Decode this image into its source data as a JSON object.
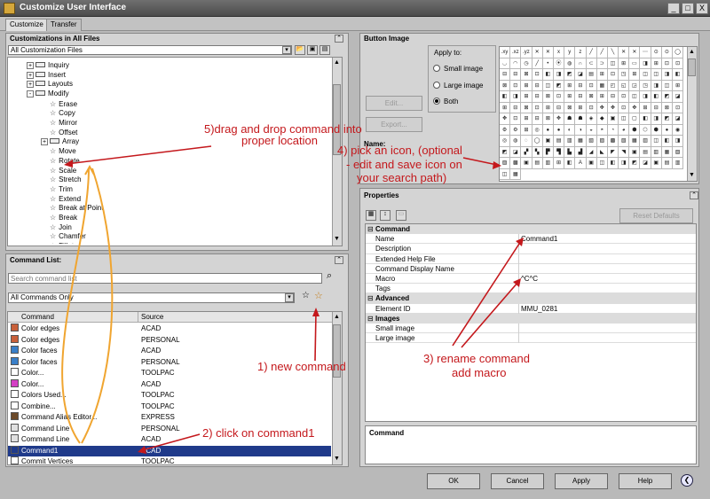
{
  "window": {
    "title": "Customize User Interface",
    "min_glyph": "_",
    "max_glyph": "□",
    "close_glyph": "X"
  },
  "tabs": [
    "Customize",
    "Transfer"
  ],
  "customizations": {
    "title": "Customizations in All Files",
    "files_dropdown": "All Customization Files",
    "tree": [
      {
        "label": "Inquiry",
        "depth": 0,
        "expand": "+",
        "kind": "folder"
      },
      {
        "label": "Insert",
        "depth": 0,
        "expand": "+",
        "kind": "folder"
      },
      {
        "label": "Layouts",
        "depth": 0,
        "expand": "+",
        "kind": "folder"
      },
      {
        "label": "Modify",
        "depth": 0,
        "expand": "-",
        "kind": "folder"
      },
      {
        "label": "Erase",
        "depth": 1,
        "kind": "command"
      },
      {
        "label": "Copy",
        "depth": 1,
        "kind": "command"
      },
      {
        "label": "Mirror",
        "depth": 1,
        "kind": "command"
      },
      {
        "label": "Offset",
        "depth": 1,
        "kind": "command"
      },
      {
        "label": "Array",
        "depth": 1,
        "expand": "+",
        "kind": "folder"
      },
      {
        "label": "Move",
        "depth": 1,
        "kind": "command"
      },
      {
        "label": "Rotate",
        "depth": 1,
        "kind": "command"
      },
      {
        "label": "Scale",
        "depth": 1,
        "kind": "command"
      },
      {
        "label": "Stretch",
        "depth": 1,
        "kind": "command"
      },
      {
        "label": "Trim",
        "depth": 1,
        "kind": "command"
      },
      {
        "label": "Extend",
        "depth": 1,
        "kind": "command"
      },
      {
        "label": "Break at Point",
        "depth": 1,
        "kind": "command"
      },
      {
        "label": "Break",
        "depth": 1,
        "kind": "command"
      },
      {
        "label": "Join",
        "depth": 1,
        "kind": "command"
      },
      {
        "label": "Chamfer",
        "depth": 1,
        "kind": "command"
      },
      {
        "label": "Fillet",
        "depth": 1,
        "kind": "command"
      }
    ]
  },
  "command_list": {
    "title": "Command List:",
    "search_placeholder": "Search command list",
    "filter": "All Commands Only",
    "columns": [
      "Command",
      "Source"
    ],
    "rows": [
      {
        "name": "Color edges",
        "source": "ACAD",
        "icon_color": "#c8603a"
      },
      {
        "name": "Color edges",
        "source": "PERSONAL",
        "icon_color": "#c8603a"
      },
      {
        "name": "Color faces",
        "source": "ACAD",
        "icon_color": "#3a7fc8"
      },
      {
        "name": "Color faces",
        "source": "PERSONAL",
        "icon_color": "#3a7fc8"
      },
      {
        "name": "Color...",
        "source": "TOOLPAC",
        "icon_color": "#ffffff"
      },
      {
        "name": "Color...",
        "source": "ACAD",
        "icon_color": "#d43fc4"
      },
      {
        "name": "Colors Used...",
        "source": "TOOLPAC",
        "icon_color": "#ffffff"
      },
      {
        "name": "Combine...",
        "source": "TOOLPAC",
        "icon_color": "#ffffff"
      },
      {
        "name": "Command Alias Editor...",
        "source": "EXPRESS",
        "icon_color": "#6c4a2a"
      },
      {
        "name": "Command Line",
        "source": "PERSONAL",
        "icon_color": "#e0e0e0"
      },
      {
        "name": "Command Line",
        "source": "ACAD",
        "icon_color": "#e0e0e0"
      },
      {
        "name": "Command1",
        "source": "ACAD",
        "icon_color": "#1f3a8a",
        "selected": true
      },
      {
        "name": "Commit Vertices",
        "source": "TOOLPAC",
        "icon_color": "#ffffff"
      }
    ]
  },
  "button_image": {
    "title": "Button Image",
    "apply_to_label": "Apply to:",
    "options": [
      "Small image",
      "Large image",
      "Both"
    ],
    "selected_option": "Both",
    "edit_label": "Edit...",
    "export_label": "Export...",
    "name_label": "Name:",
    "icons": [
      ".xy",
      ".xz",
      ".yz",
      "✕",
      "✕",
      "x",
      "y",
      "z",
      "╱",
      "╱",
      "╲",
      "✕",
      "✕",
      "⋯",
      "⊙",
      "⊙",
      "◯",
      "◡",
      "◠",
      "◷",
      "╱",
      "•",
      "⦿",
      "◍",
      "∩",
      "⊂",
      "⊃",
      "◫",
      "⊞",
      "▭",
      "◨",
      "⊞",
      "⊡",
      "⊡",
      "⊟",
      "⊟",
      "⊠",
      "⊡",
      "◧",
      "◨",
      "◩",
      "◪",
      "▤",
      "⊞",
      "⊡",
      "◳",
      "⊞",
      "◫",
      "◫",
      "◨",
      "◧",
      "⊠",
      "⊡",
      "⊞",
      "⊟",
      "◫",
      "◩",
      "⊞",
      "⊟",
      "⊡",
      "▦",
      "◰",
      "◱",
      "◲",
      "◳",
      "◨",
      "◫",
      "⊞",
      "◧",
      "◨",
      "⊞",
      "⊟",
      "⊠",
      "⊡",
      "⊞",
      "⊟",
      "⊠",
      "⊞",
      "⊟",
      "⊡",
      "◫",
      "◨",
      "◧",
      "◩",
      "◪",
      "⊞",
      "⊟",
      "⊠",
      "⊡",
      "⊞",
      "⊟",
      "⊠",
      "⊞",
      "⊡",
      "✥",
      "✥",
      "⊡",
      "✥",
      "⊞",
      "⊟",
      "⊠",
      "⊡",
      "✥",
      "⊡",
      "⊞",
      "⊟",
      "⊠",
      "✥",
      "☗",
      "☗",
      "◈",
      "◆",
      "▣",
      "◫",
      "▢",
      "◧",
      "◨",
      "◩",
      "◪",
      "⚙",
      "⚙",
      "⊞",
      "◎",
      "●",
      "●",
      "◐",
      "◑",
      "◒",
      "◓",
      "◔",
      "◕",
      "⬢",
      "⬡",
      "⬢",
      "●",
      "◉",
      "◎",
      "◍",
      "◌",
      "◯",
      "▣",
      "▤",
      "▥",
      "▦",
      "▧",
      "▨",
      "▩",
      "▧",
      "▦",
      "▥",
      "◫",
      "◧",
      "◨",
      "◩",
      "◪",
      "▞",
      "▚",
      "▛",
      "▜",
      "▙",
      "▟",
      "◢",
      "◣",
      "◤",
      "◥",
      "▣",
      "▤",
      "▥",
      "▦",
      "▧",
      "▨",
      "▩",
      "▣",
      "▤",
      "▥",
      "⊞",
      "◧",
      "A",
      "▣",
      "◫",
      "◧",
      "◨",
      "◩",
      "◪",
      "▣",
      "▤",
      "▥",
      "◫",
      "▦"
    ]
  },
  "properties": {
    "title": "Properties",
    "reset_label": "Reset Defaults",
    "rows": [
      {
        "cat": "Command"
      },
      {
        "k": "Name",
        "v": "Command1"
      },
      {
        "k": "Description",
        "v": ""
      },
      {
        "k": "Extended Help File",
        "v": ""
      },
      {
        "k": "Command Display Name",
        "v": ""
      },
      {
        "k": "Macro",
        "v": "^C^C"
      },
      {
        "k": "Tags",
        "v": ""
      },
      {
        "cat": "Advanced"
      },
      {
        "k": "Element ID",
        "v": "MMU_0281"
      },
      {
        "cat": "Images"
      },
      {
        "k": "Small image",
        "v": ""
      },
      {
        "k": "Large image",
        "v": ""
      }
    ],
    "description_label": "Command"
  },
  "footer": {
    "ok": "OK",
    "cancel": "Cancel",
    "apply": "Apply",
    "help": "Help",
    "collapse_glyph": "❮"
  },
  "annotations": {
    "n1": "1) new command",
    "n2": "2) click on command1",
    "n3a": "3) rename command",
    "n3b": "add macro",
    "n4a": "4) pick an icon, (optional",
    "n4b": "- edit and save icon on",
    "n4c": "your search path)",
    "n5a": "5)drag and drop command into",
    "n5b": "proper location"
  },
  "colors": {
    "annotation_red": "#c4181c",
    "drag_path": "#f0a530",
    "selection": "#1f3a8a"
  }
}
